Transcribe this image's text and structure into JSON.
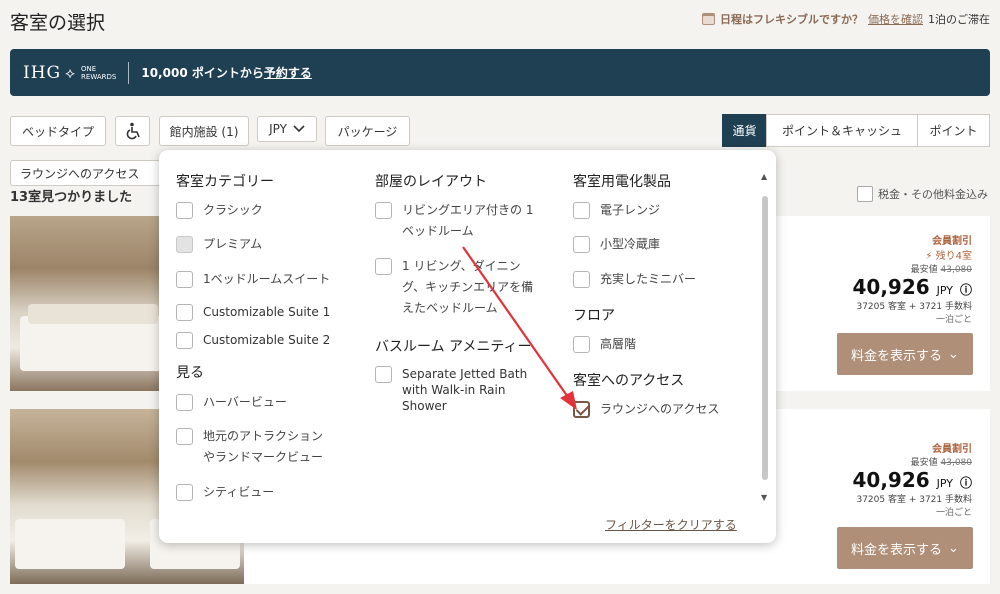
{
  "header": {
    "title": "客室の選択",
    "flex_question": "日程はフレキシブルですか？",
    "flex_link": "価格を確認",
    "flex_suffix": "1泊のご滞在"
  },
  "banner": {
    "brand": "IHG",
    "brand_sub_1": "ONE",
    "brand_sub_2": "REWARDS",
    "points_text": "10,000 ポイントから",
    "points_link": "予約する"
  },
  "filters": {
    "bed_type": "ベッドタイプ",
    "accessibility_icon": "wheelchair-icon",
    "amenities": "館内施設 (1)",
    "currency_select": "JPY",
    "package": "パッケージ",
    "applied_chip": "ラウンジへのアクセス"
  },
  "pay_toggle": [
    "通貨",
    "ポイント＆キャッシュ",
    "ポイント"
  ],
  "results": {
    "count": "13室見つかりました",
    "tax_label": "税金・その他料金込み"
  },
  "rooms": [
    {
      "member": "会員割引",
      "left": "残り4室",
      "lowest_label": "最安値",
      "lowest_old": "43,080",
      "price": "40,926",
      "currency": "JPY",
      "breakdown": "37205 客室 + 3721 手数料",
      "per": "一泊ごと",
      "button": "料金を表示する"
    },
    {
      "member": "会員割引",
      "lowest_label": "最安値",
      "lowest_old": "43,080",
      "price": "40,926",
      "currency": "JPY",
      "breakdown": "37205 客室 + 3721 手数料",
      "per": "一泊ごと",
      "button": "料金を表示する"
    }
  ],
  "dropdown": {
    "col1": {
      "heading": "客室カテゴリー",
      "options": [
        "クラシック",
        "プレミアム",
        "1ベッドルームスイート",
        "Customizable Suite 1",
        "Customizable Suite 2"
      ],
      "view_heading": "見る",
      "view_options": [
        "ハーバービュー",
        "地元のアトラクション",
        "やランドマークビュー",
        "シティビュー"
      ]
    },
    "col2": {
      "heading": "部屋のレイアウト",
      "opt1_l1": "リビングエリア付きの 1",
      "opt1_l2": "ベッドルーム",
      "opt2_l1": "1 リビング、ダイニン",
      "opt2_l2": "グ、キッチンエリアを備",
      "opt2_l3": "えたベッドルーム",
      "bath_heading": "バスルーム アメニティー",
      "bath_l1": "Separate Jetted Bath",
      "bath_l2": "with Walk-in Rain",
      "bath_l3": "Shower"
    },
    "col3": {
      "heading": "客室用電化製品",
      "options": [
        "電子レンジ",
        "小型冷蔵庫",
        "充実したミニバー"
      ],
      "floor_heading": "フロア",
      "floor_options": [
        "高層階"
      ],
      "access_heading": "客室へのアクセス",
      "access_options": [
        "ラウンジへのアクセス"
      ]
    },
    "clear": "フィルターをクリアする"
  },
  "colors": {
    "navy": "#1f3f52",
    "accent": "#b08f79",
    "arrow": "#e3333a"
  }
}
